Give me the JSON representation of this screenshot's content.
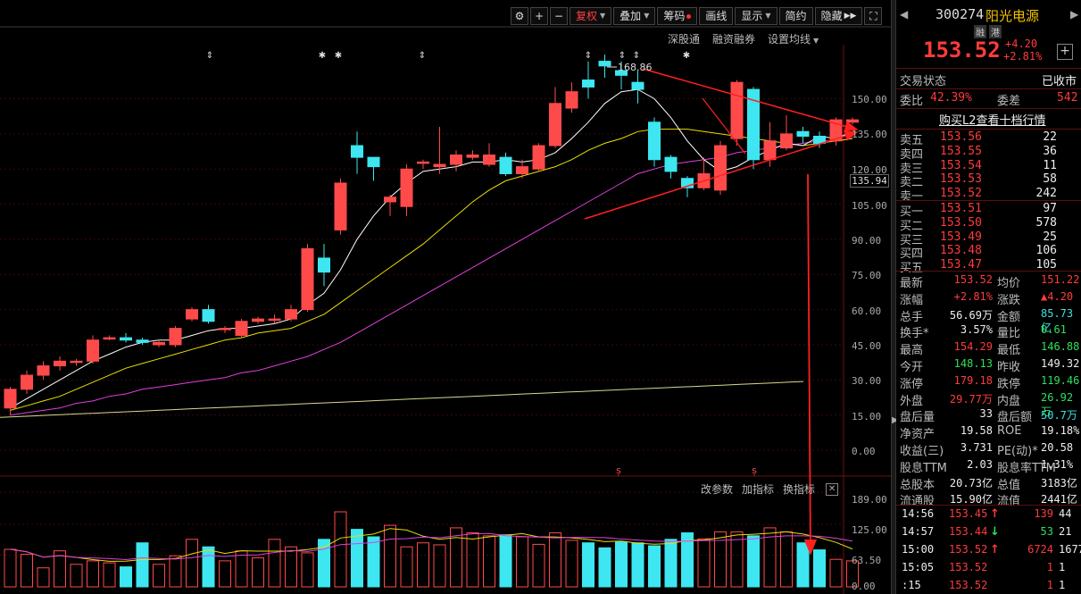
{
  "toolbar": {
    "fuquan": "复权",
    "diejia": "叠加",
    "chouma": "筹码",
    "huaxian": "画线",
    "xianshi": "显示",
    "jianyue": "简约",
    "yincang": "隐藏"
  },
  "subbar": [
    "深股通",
    "融资融券",
    "设置均线"
  ],
  "vol_toolbar": [
    "改参数",
    "加指标",
    "换指标"
  ],
  "price_axis": [
    "150.00",
    "135.00",
    "120.00",
    "105.00",
    "90.00",
    "75.00",
    "60.00",
    "45.00",
    "30.00",
    "15.00",
    "0.00"
  ],
  "vol_axis": [
    "189.00",
    "125.00",
    "63.50",
    "0.00"
  ],
  "current_price_label": "135.94",
  "peak_label": "168.86",
  "colors": {
    "up": "#ff4a4a",
    "down": "#3de6f0",
    "ma5": "#ffffff",
    "ma10": "#e8e000",
    "ma20": "#e040e0",
    "ma60": "#d8d890",
    "arrow": "#ff2020"
  },
  "stock": {
    "code": "300274",
    "name": "阳光电源",
    "tag1": "融",
    "tag2": "港",
    "price": "153.52",
    "change": "+4.20",
    "change_pct": "+2.81%"
  },
  "trade_status": {
    "label": "交易状态",
    "value": "已收市"
  },
  "weibi": {
    "label1": "委比",
    "value1": "42.39%",
    "label2": "委差",
    "value2": "542"
  },
  "l2_link": "购买L2查看十档行情",
  "asks": [
    {
      "label": "卖五",
      "price": "153.56",
      "vol": "22"
    },
    {
      "label": "卖四",
      "price": "153.55",
      "vol": "36"
    },
    {
      "label": "卖三",
      "price": "153.54",
      "vol": "11"
    },
    {
      "label": "卖二",
      "price": "153.53",
      "vol": "58"
    },
    {
      "label": "卖一",
      "price": "153.52",
      "vol": "242"
    }
  ],
  "bids": [
    {
      "label": "买一",
      "price": "153.51",
      "vol": "97"
    },
    {
      "label": "买二",
      "price": "153.50",
      "vol": "578"
    },
    {
      "label": "买三",
      "price": "153.49",
      "vol": "25"
    },
    {
      "label": "买四",
      "price": "153.48",
      "vol": "106"
    },
    {
      "label": "买五",
      "price": "153.47",
      "vol": "105"
    }
  ],
  "stats": [
    {
      "l1": "最新",
      "v1": "153.52",
      "c1": "red",
      "l2": "均价",
      "v2": "151.22",
      "c2": "red"
    },
    {
      "l1": "涨幅",
      "v1": "+2.81%",
      "c1": "red",
      "l2": "涨跌",
      "v2": "▲4.20",
      "c2": "red"
    },
    {
      "l1": "总手",
      "v1": "56.69万",
      "c1": "white",
      "l2": "金额",
      "v2": "85.73亿",
      "c2": "cyan"
    },
    {
      "l1": "换手*",
      "v1": "3.57%",
      "c1": "white",
      "l2": "量比",
      "v2": "0.61",
      "c2": "green"
    },
    {
      "l1": "最高",
      "v1": "154.29",
      "c1": "red",
      "l2": "最低",
      "v2": "146.88",
      "c2": "green"
    },
    {
      "l1": "今开",
      "v1": "148.13",
      "c1": "green",
      "l2": "昨收",
      "v2": "149.32",
      "c2": "white"
    },
    {
      "l1": "涨停",
      "v1": "179.18",
      "c1": "red",
      "l2": "跌停",
      "v2": "119.46",
      "c2": "green"
    },
    {
      "l1": "外盘",
      "v1": "29.77万",
      "c1": "red",
      "l2": "内盘",
      "v2": "26.92万",
      "c2": "green"
    },
    {
      "l1": "盘后量",
      "v1": "33",
      "c1": "white",
      "l2": "盘后额",
      "v2": "50.7万",
      "c2": "cyan"
    },
    {
      "l1": "净资产",
      "v1": "19.58",
      "c1": "white",
      "l2": "ROE",
      "v2": "19.18%",
      "c2": "white"
    },
    {
      "l1": "收益(三)",
      "v1": "3.731",
      "c1": "white",
      "l2": "PE(动)*",
      "v2": "20.58",
      "c2": "white"
    },
    {
      "l1": "股息TTM",
      "v1": "2.03",
      "c1": "white",
      "l2": "股息率TTM",
      "v2": "1.31%",
      "c2": "white"
    },
    {
      "l1": "总股本",
      "v1": "20.73亿",
      "c1": "white",
      "l2": "总值",
      "v2": "3183亿",
      "c2": "white"
    },
    {
      "l1": "流通股",
      "v1": "15.90亿",
      "c1": "white",
      "l2": "流值",
      "v2": "2441亿",
      "c2": "white"
    }
  ],
  "ticks": [
    {
      "time": "14:56",
      "price": "153.45",
      "dir": "up",
      "vol": "139",
      "extra": "44"
    },
    {
      "time": "14:57",
      "price": "153.44",
      "dir": "down",
      "vol": "53",
      "extra": "21"
    },
    {
      "time": "15:00",
      "price": "153.52",
      "dir": "up",
      "vol": "6724",
      "extra": "1677"
    },
    {
      "time": "15:05",
      "price": "153.52",
      "dir": "",
      "vol": "1",
      "extra": "1"
    },
    {
      "time": ":15",
      "price": "153.52",
      "dir": "",
      "vol": "1",
      "extra": "1"
    }
  ],
  "chart_data": {
    "type": "candlestick",
    "price_ylim": [
      0,
      160
    ],
    "volume_ylim": [
      0,
      189
    ],
    "candles": [
      [
        18,
        26,
        15,
        27
      ],
      [
        26,
        32,
        24,
        34
      ],
      [
        32,
        36,
        30,
        38
      ],
      [
        36,
        38,
        34,
        40
      ],
      [
        38,
        38,
        36,
        39
      ],
      [
        38,
        47,
        37,
        49
      ],
      [
        48,
        48,
        47,
        49
      ],
      [
        48,
        47,
        46,
        50
      ],
      [
        47,
        46,
        45,
        48
      ],
      [
        45,
        46,
        44,
        47
      ],
      [
        45,
        52,
        44,
        53
      ],
      [
        56,
        60,
        55,
        61
      ],
      [
        60,
        55,
        54,
        62
      ],
      [
        52,
        52,
        50,
        53
      ],
      [
        49,
        55,
        48,
        56
      ],
      [
        55,
        56,
        54,
        57
      ],
      [
        56,
        56,
        54,
        58
      ],
      [
        56,
        60,
        55,
        62
      ],
      [
        60,
        86,
        59,
        88
      ],
      [
        82,
        76,
        70,
        88
      ],
      [
        94,
        114,
        92,
        116
      ],
      [
        130,
        125,
        118,
        136
      ],
      [
        125,
        121,
        115,
        125
      ],
      [
        106,
        108,
        100,
        109
      ],
      [
        104,
        120,
        100,
        122
      ],
      [
        123,
        123,
        120,
        124
      ],
      [
        121,
        122,
        118,
        138
      ],
      [
        122,
        126,
        119,
        128
      ],
      [
        125,
        126,
        124,
        128
      ],
      [
        122,
        126,
        121,
        131
      ],
      [
        125,
        118,
        117,
        127
      ],
      [
        118,
        121,
        116,
        124
      ],
      [
        120,
        130,
        119,
        131
      ],
      [
        130,
        148,
        129,
        155
      ],
      [
        146,
        153,
        144,
        157
      ],
      [
        158,
        155,
        150,
        166
      ],
      [
        166,
        164,
        159,
        168.86
      ],
      [
        162,
        160,
        154,
        166
      ],
      [
        157,
        154,
        148,
        162
      ],
      [
        140,
        124,
        121,
        142
      ],
      [
        125,
        119,
        116,
        126
      ],
      [
        116,
        112,
        108,
        117
      ],
      [
        112,
        118,
        111,
        125
      ],
      [
        111,
        130,
        109,
        132
      ],
      [
        133,
        157,
        130,
        158
      ],
      [
        154,
        124,
        120,
        155
      ],
      [
        124,
        132,
        121,
        140
      ],
      [
        129,
        135,
        128,
        143
      ],
      [
        136,
        134,
        131,
        138
      ],
      [
        134,
        131,
        129,
        136
      ],
      [
        132,
        141,
        130,
        142
      ],
      [
        140,
        141,
        139,
        142
      ]
    ],
    "volumes": [
      75,
      65,
      38,
      72,
      45,
      52,
      48,
      40,
      88,
      45,
      62,
      95,
      80,
      52,
      72,
      58,
      95,
      80,
      68,
      95,
      150,
      115,
      100,
      123,
      80,
      88,
      84,
      118,
      108,
      102,
      104,
      100,
      85,
      108,
      93,
      88,
      78,
      90,
      88,
      82,
      95,
      108,
      96,
      110,
      110,
      102,
      118,
      110,
      88,
      74,
      55,
      52
    ],
    "ma5": [
      18,
      22,
      26,
      30,
      34,
      38,
      41,
      44,
      46,
      47,
      47,
      49,
      51,
      52,
      52,
      53,
      54,
      56,
      62,
      67,
      77,
      90,
      100,
      108,
      114,
      119,
      120,
      121,
      123,
      123,
      124,
      123,
      124,
      127,
      133,
      140,
      148,
      153,
      154,
      150,
      142,
      132,
      124,
      119,
      121,
      125,
      128,
      131,
      130,
      134,
      133,
      136
    ],
    "ma10": [
      17,
      19,
      21,
      23,
      26,
      29,
      32,
      35,
      37,
      39,
      41,
      43,
      45,
      47,
      48,
      50,
      51,
      52,
      55,
      58,
      63,
      68,
      73,
      78,
      83,
      88,
      94,
      100,
      106,
      111,
      115,
      117,
      119,
      121,
      124,
      128,
      131,
      133,
      136,
      137,
      137,
      137,
      136,
      135,
      134,
      133,
      132,
      131,
      130,
      131,
      132,
      133
    ],
    "ma20": [
      15,
      16,
      17,
      18,
      20,
      21,
      23,
      24,
      26,
      27,
      28,
      29,
      30,
      31,
      33,
      34,
      36,
      38,
      40,
      43,
      46,
      50,
      54,
      58,
      62,
      66,
      70,
      74,
      78,
      82,
      86,
      90,
      94,
      98,
      102,
      106,
      110,
      114,
      118,
      120,
      122,
      123,
      124,
      125,
      127,
      128,
      129,
      130,
      131,
      132,
      132,
      133
    ],
    "ma60": [
      14,
      14.3,
      14.6,
      14.9,
      15.2,
      15.5,
      15.8,
      16.1,
      16.4,
      16.7,
      17,
      17.3,
      17.6,
      17.9,
      18.2,
      18.5,
      18.8,
      19.1,
      19.4,
      19.7,
      20,
      20.3,
      20.6,
      20.9,
      21.2,
      21.5,
      21.8,
      22.1,
      22.4,
      22.7,
      23,
      23.3,
      23.6,
      23.9,
      24.2,
      24.5,
      24.8,
      25.1,
      25.4,
      25.7,
      26,
      26.3,
      26.6,
      26.9,
      27.2,
      27.5,
      27.8,
      28.1,
      28.4,
      28.7,
      29,
      29.3
    ]
  }
}
